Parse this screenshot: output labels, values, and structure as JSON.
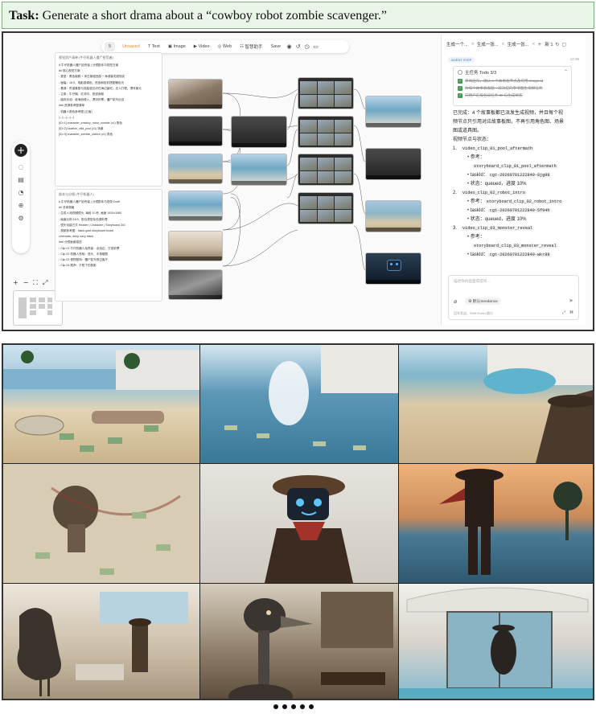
{
  "task": {
    "prefix": "Task:",
    "text": "Generate a short drama about a “cowboy robot zombie scavenger.”"
  },
  "toolbar": {
    "count": "5",
    "saved": "Unsaved",
    "items": [
      "Text",
      "Image",
      "Video",
      "Web",
      "智慧助手"
    ],
    "save_label": "Save",
    "icons": [
      "camera-icon",
      "history-icon",
      "clock-icon",
      "chat-icon"
    ]
  },
  "rail": {
    "icons": [
      "plus-icon",
      "chat-icon",
      "layers-icon",
      "history-icon",
      "add-node-icon",
      "settings-icon"
    ]
  },
  "zoom": {
    "labels": [
      "+",
      "−",
      "⛶",
      "⤢"
    ]
  },
  "text_nodes": [
    {
      "title": "视觉资产清单 (牛仔机器人僵尸拾荒者)",
      "lines": [
        "# 牛仔机器人僵尸拾荒者 | 分镜剧本与视觉方案",
        "## 核心视觉方案",
        "- 类型：黑色幽默 + 末日废墟西部 + 海滨豪宅超现实",
        "- 画幅：16:9，电影感调色，低饱和色彩搭配暖色光",
        "- 基调：荒诞喜剧与孤独感交织在海边豪宅；无人打理，漂浮美元",
        "- 主角：牛仔帽，红领巾，铁皮身躯",
        "- 废弃泳池：被海浪侵入，漂浮钞票；僵尸鸵鸟出没",
        "### 资源参考图清单",
        "- 机器人角色参考图 (正面)",
        "|---|---|---|---|",
        "[ID=1] character_cowboy_robot_zombie (v1) 角色",
        "[ID=2] location_villa_pool (v1) 场景",
        "[ID=3] character_zombie_ostrich (v1) 角色"
      ]
    },
    {
      "title": "剧本与分镜 (牛仔机器人)",
      "lines": [
        "# 牛仔机器人僵尸拾荒者 | 分镜剧本与视觉 Draft",
        "## 总体规格",
        "- 生成 4 段视频镜头, 每段 10 秒, 画面 1920x1080",
        "- 画面比例 16:9，配合类型化色调处理",
        "- 镜头衔接方式 Header | Character | Storyboard 3x3",
        "- 视频参考图：black-gold storyboard board",
        "  cinematic; deep navy black",
        "### 分镜画面描述",
        "- Clip 01 牛仔机器人拾荒者：泳池边，打捞钞票",
        "- Clip 02 机器人亮相：低头，手按帽檐",
        "- Clip 03 怪物登场：僵尸鸵鸟穿过客厅",
        "- Clip 04 尾声：夕阳下的剪影"
      ]
    }
  ],
  "chat": {
    "tabs": [
      {
        "label": "生成一个...",
        "close": "×"
      },
      {
        "label": "生成一张...",
        "close": "×"
      },
      {
        "label": "生成一张...",
        "close": "×"
      },
      {
        "label": "新 1",
        "close": ""
      }
    ],
    "badge": "AGENT STEP",
    "time": "12:39",
    "todo": {
      "title": "主任务 Todo 3/3",
      "items": [
        "审阅画布，确认 4 个故事板节点及可用 image.id",
        "为每个故事板发起一段对应的参考图生视频任务",
        "向用户汇报各段任务 ID 与生成状态"
      ]
    },
    "summary": [
      "已完成：4 个故事板都已派发生成视频，并且每个视",
      "频节点只引用对应故事板图，不再引用角色图、场景",
      "图或道具图。",
      "视频节点与状态："
    ],
    "clips": [
      {
        "num": "1.",
        "name": "video_clip_01_pool_aftermath",
        "ref_label": "参考：",
        "ref": "storyboard_clip_01_pool_aftermath",
        "task_label": "taskId：",
        "task": "cgt-20260701222849-8jg98",
        "status_label": "状态：",
        "status": "queued，进度 10%"
      },
      {
        "num": "2.",
        "name": "video_clip_02_robot_intro",
        "ref_label": "参考：",
        "ref": "storyboard_clip_02_robot_intro",
        "task_label": "taskId：",
        "task": "cgt-20260701222849-5f94h",
        "status_label": "状态：",
        "status": "queued，进度 10%"
      },
      {
        "num": "3.",
        "name": "video_clip_03_monster_reveal",
        "ref_label": "参考：",
        "ref": "storyboard_clip_03_monster_reveal",
        "task_label": "taskId：",
        "task": "cgt-20260701222849-wkr88",
        "status_label": "",
        "status": ""
      }
    ],
    "input": {
      "placeholder": "描述你的画面或提问...",
      "model": "⚙ 默认Seedance",
      "hint": "回车发送，Shift+Enter 换行",
      "send": "➤"
    }
  },
  "gallery": {
    "cells": [
      {
        "name": "frame-bottle-hand-beach"
      },
      {
        "name": "frame-pool-splash"
      },
      {
        "name": "frame-cowboy-overlooking-beach"
      },
      {
        "name": "frame-robot-topdown-sand"
      },
      {
        "name": "frame-robot-blue-screen-face"
      },
      {
        "name": "frame-robot-silhouette-sunset"
      },
      {
        "name": "frame-ostrich-living-room"
      },
      {
        "name": "frame-zombie-ostrich-closeup"
      },
      {
        "name": "frame-figure-behind-glass"
      }
    ],
    "page_dots": 5
  },
  "colors": {
    "accent_green": "#3aa04a",
    "task_bg": "#e9f5e6",
    "badge_blue": "#4a6fb5"
  }
}
